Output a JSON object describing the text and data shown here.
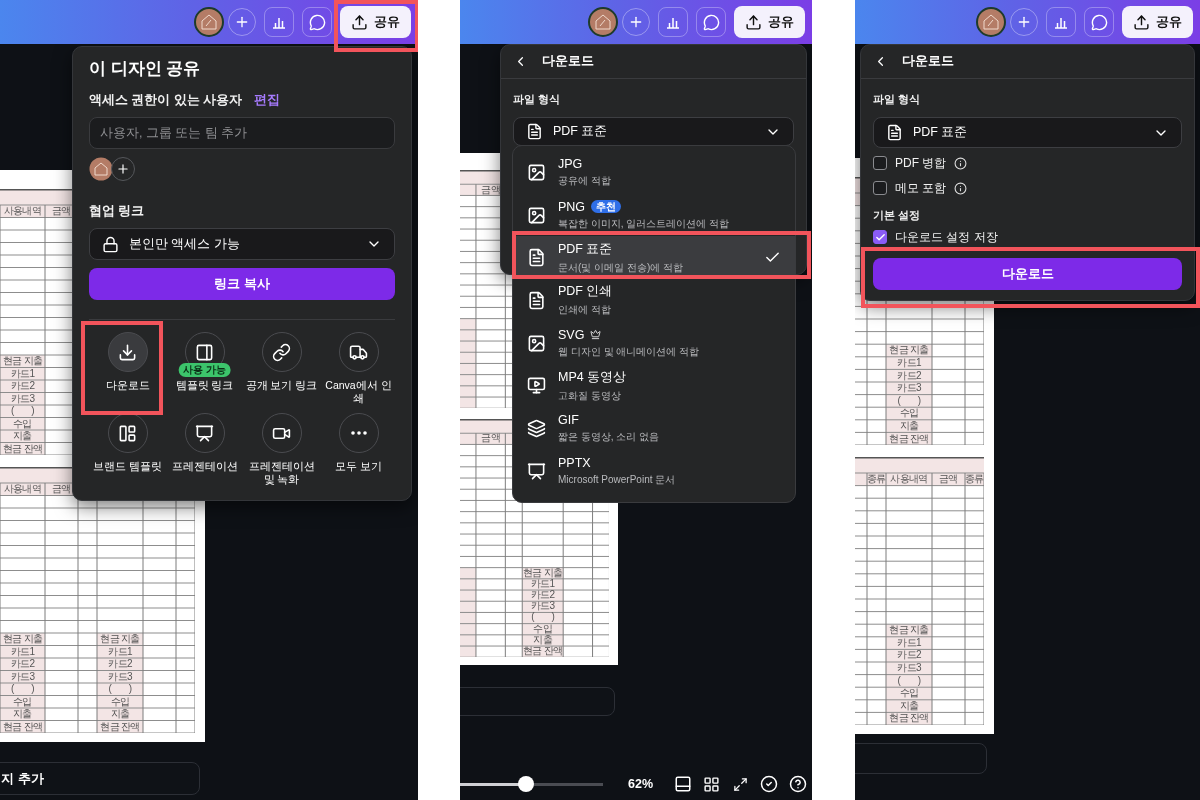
{
  "panels": [
    {
      "top_bar": {
        "share": {
          "label": "공유",
          "highlighted": true
        }
      },
      "share_menu": {
        "title": "이 디자인 공유",
        "access_label": "액세스 권한이 있는 사용자",
        "edit_link": "편집",
        "people_field": {
          "placeholder": "사용자, 그룹 또는 팀 추가"
        },
        "collab_label": "협업 링크",
        "access_select": "본인만 액세스 가능",
        "copy_button": "링크 복사",
        "tiles": [
          {
            "kind": "download",
            "label": "다운로드",
            "highlighted": true
          },
          {
            "kind": "template",
            "label": "템플릿 링크",
            "badge": "사용 가능",
            "highlighted": false
          },
          {
            "kind": "link",
            "label": "공개 보기 링크",
            "highlighted": false
          },
          {
            "kind": "print",
            "label": "Canva에서 인쇄",
            "highlighted": false
          },
          {
            "kind": "brand",
            "label": "브랜드 템플릿",
            "highlighted": false
          },
          {
            "kind": "presentation",
            "label": "프레젠테이션",
            "highlighted": false
          },
          {
            "kind": "recording",
            "label": "프레젠테이션 및 녹화",
            "highlighted": false
          },
          {
            "kind": "more",
            "label": "모두 보기",
            "highlighted": false
          }
        ]
      },
      "document": {
        "blocks": [
          {
            "header": {
              "usage_1": "사용내역",
              "amount_1": "금액"
            },
            "labels_1": [
              "현금 지출",
              "카드1",
              "카드2",
              "카드3",
              "(        )",
              "수입",
              "지출",
              "현금 잔액"
            ]
          },
          {
            "header": {
              "usage_1": "사용내역",
              "amount_1": "금액"
            },
            "labels_1": [
              "현금 지출",
              "카드1",
              "카드2",
              "카드3",
              "(        )",
              "수입",
              "지출",
              "현금 잔액"
            ],
            "labels_2": [
              "현금 지출",
              "카드1",
              "카드2",
              "카드3",
              "(        )",
              "수입",
              "지출",
              "현금 잔액"
            ]
          }
        ]
      },
      "add_page": {
        "label": "지 추가"
      }
    },
    {
      "top_bar": {
        "share": {
          "label": "공유",
          "highlighted": false
        }
      },
      "download_menu": {
        "title": "다운로드",
        "format_label": "파일 형식",
        "format_select": "PDF 표준"
      },
      "format_list": [
        {
          "kind": "image",
          "label": "JPG",
          "note": "공유에 적합",
          "selected": false,
          "highlighted": false
        },
        {
          "kind": "image",
          "label": "PNG",
          "badge": "추천",
          "note": "복잡한 이미지, 일러스트레이션에 적합",
          "selected": false,
          "highlighted": false
        },
        {
          "kind": "document",
          "label": "PDF 표준",
          "note": "문서(및 이메일 전송)에 적합",
          "selected": true,
          "highlighted": true
        },
        {
          "kind": "document",
          "label": "PDF 인쇄",
          "note": "인쇄에 적합",
          "selected": false,
          "highlighted": false
        },
        {
          "kind": "image",
          "label": "SVG",
          "premium": true,
          "note": "웹 디자인 및 애니메이션에 적합",
          "selected": false,
          "highlighted": false
        },
        {
          "kind": "video",
          "label": "MP4 동영상",
          "note": "고화질 동영상",
          "selected": false,
          "highlighted": false
        },
        {
          "kind": "animation",
          "label": "GIF",
          "note": "짧은 동영상, 소리 없음",
          "selected": false,
          "highlighted": false
        },
        {
          "kind": "presentation",
          "label": "PPTX",
          "note": "Microsoft PowerPoint 문서",
          "selected": false,
          "highlighted": false
        }
      ],
      "document": {
        "blocks": [
          {
            "header": {
              "amount_1": "금액"
            }
          },
          {
            "header": {
              "amount_1": "금액"
            },
            "labels_2": [
              "현금 지출",
              "카드1",
              "카드2",
              "카드3",
              "(        )",
              "수입",
              "지출",
              "현금 잔액"
            ]
          }
        ]
      },
      "zoom": {
        "level": 0.46,
        "reading": "62%"
      }
    },
    {
      "top_bar": {
        "share": {
          "label": "공유",
          "highlighted": false
        }
      },
      "download_menu": {
        "title": "다운로드",
        "format_label": "파일 형식",
        "format_select": "PDF 표준",
        "options": [
          {
            "label": "PDF 병합",
            "checked": false,
            "info": true
          },
          {
            "label": "메모 포함",
            "checked": false,
            "info": true
          }
        ],
        "defaults_label": "기본 설정",
        "save_option": {
          "label": "다운로드 설정 저장",
          "checked": true
        },
        "download_button": {
          "label": "다운로드",
          "highlighted": true
        }
      },
      "document": {
        "blocks": [
          {
            "labels_2": [
              "현금 지출",
              "카드1",
              "카드2",
              "카드3",
              "(        )",
              "수입",
              "지출",
              "현금 잔액"
            ]
          },
          {
            "header": {
              "kind_2": "종류",
              "usage_2": "사용내역",
              "amount_2": "금액",
              "kind_3": "종류"
            },
            "labels_2": [
              "현금 지출",
              "카드1",
              "카드2",
              "카드3",
              "(        )",
              "수입",
              "지출",
              "현금 잔액"
            ]
          }
        ]
      }
    }
  ]
}
